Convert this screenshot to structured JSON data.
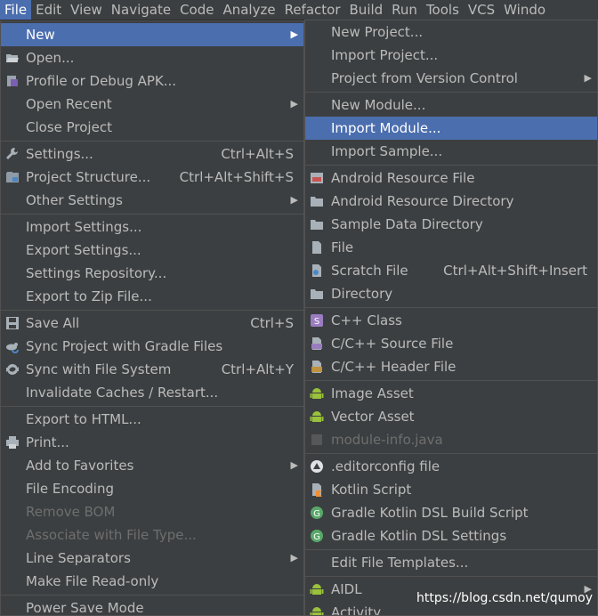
{
  "menubar": [
    "File",
    "Edit",
    "View",
    "Navigate",
    "Code",
    "Analyze",
    "Refactor",
    "Build",
    "Run",
    "Tools",
    "VCS",
    "Windo"
  ],
  "file_menu": {
    "new": "New",
    "open": "Open...",
    "profile_debug_apk": "Profile or Debug APK...",
    "open_recent": "Open Recent",
    "close_project": "Close Project",
    "settings": "Settings...",
    "settings_shortcut": "Ctrl+Alt+S",
    "project_structure": "Project Structure...",
    "project_structure_shortcut": "Ctrl+Alt+Shift+S",
    "other_settings": "Other Settings",
    "import_settings": "Import Settings...",
    "export_settings": "Export Settings...",
    "settings_repository": "Settings Repository...",
    "export_zip": "Export to Zip File...",
    "save_all": "Save All",
    "save_all_shortcut": "Ctrl+S",
    "sync_gradle": "Sync Project with Gradle Files",
    "sync_fs": "Sync with File System",
    "sync_fs_shortcut": "Ctrl+Alt+Y",
    "invalidate_caches": "Invalidate Caches / Restart...",
    "export_html": "Export to HTML...",
    "print": "Print...",
    "add_favorites": "Add to Favorites",
    "file_encoding": "File Encoding",
    "remove_bom": "Remove BOM",
    "associate_type": "Associate with File Type...",
    "line_separators": "Line Separators",
    "make_readonly": "Make File Read-only",
    "power_save": "Power Save Mode"
  },
  "new_menu": {
    "new_project": "New Project...",
    "import_project": "Import Project...",
    "project_vcs": "Project from Version Control",
    "new_module": "New Module...",
    "import_module": "Import Module...",
    "import_sample": "Import Sample...",
    "android_resource_file": "Android Resource File",
    "android_resource_directory": "Android Resource Directory",
    "sample_data_directory": "Sample Data Directory",
    "file": "File",
    "scratch_file": "Scratch File",
    "scratch_shortcut": "Ctrl+Alt+Shift+Insert",
    "directory": "Directory",
    "cpp_class": "C++ Class",
    "cpp_source": "C/C++ Source File",
    "cpp_header": "C/C++ Header File",
    "image_asset": "Image Asset",
    "vector_asset": "Vector Asset",
    "module_info": "module-info.java",
    "editorconfig": ".editorconfig file",
    "kotlin_script": "Kotlin Script",
    "gradle_kotlin_build": "Gradle Kotlin DSL Build Script",
    "gradle_kotlin_settings": "Gradle Kotlin DSL Settings",
    "edit_templates": "Edit File Templates...",
    "aidl": "AIDL",
    "activity": "Activity"
  },
  "watermark": "https://blog.csdn.net/qumoy",
  "colors": {
    "background": "#3c3f41",
    "selection": "#4b6eaf",
    "text": "#bbbbbb",
    "disabled": "#6e6e6e",
    "android": "#9ac13b"
  }
}
